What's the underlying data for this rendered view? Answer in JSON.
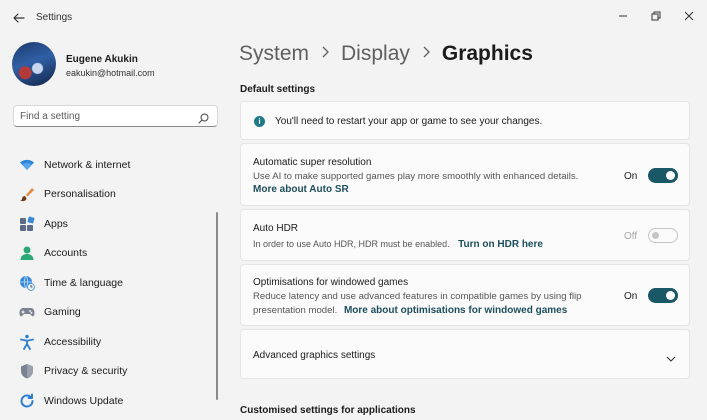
{
  "window": {
    "title": "Settings"
  },
  "profile": {
    "name": "Eugene Akukin",
    "email": "eakukin@hotmail.com"
  },
  "search": {
    "placeholder": "Find a setting"
  },
  "nav": [
    {
      "label": "Network & internet",
      "icon": "wifi-icon"
    },
    {
      "label": "Personalisation",
      "icon": "brush-icon"
    },
    {
      "label": "Apps",
      "icon": "apps-icon"
    },
    {
      "label": "Accounts",
      "icon": "person-icon"
    },
    {
      "label": "Time & language",
      "icon": "globe-clock-icon"
    },
    {
      "label": "Gaming",
      "icon": "gamepad-icon"
    },
    {
      "label": "Accessibility",
      "icon": "accessibility-icon"
    },
    {
      "label": "Privacy & security",
      "icon": "shield-icon"
    },
    {
      "label": "Windows Update",
      "icon": "update-icon"
    }
  ],
  "breadcrumb": {
    "items": [
      "System",
      "Display"
    ],
    "current": "Graphics"
  },
  "sections": {
    "default": "Default settings",
    "custom": "Customised settings for applications"
  },
  "info": {
    "text": "You'll need to restart your app or game to see your changes."
  },
  "auto_sr": {
    "title": "Automatic super resolution",
    "desc": "Use AI to make supported games play more smoothly with enhanced details.",
    "link": "More about Auto SR",
    "state_label": "On",
    "on": true
  },
  "auto_hdr": {
    "title": "Auto HDR",
    "desc": "In order to use Auto HDR, HDR must be enabled.",
    "link": "Turn on HDR here",
    "state_label": "Off",
    "on": false
  },
  "windowed": {
    "title": "Optimisations for windowed games",
    "desc_line1": "Reduce latency and use advanced features in compatible games by using flip",
    "desc_line2": "presentation model.",
    "link": "More about optimisations for windowed games",
    "state_label": "On",
    "on": true
  },
  "advanced": {
    "title": "Advanced graphics settings"
  },
  "colors": {
    "accent": "#1a5868",
    "link": "#1d4e5e",
    "background": "#f3f3f3",
    "card": "#fbfbfb"
  }
}
